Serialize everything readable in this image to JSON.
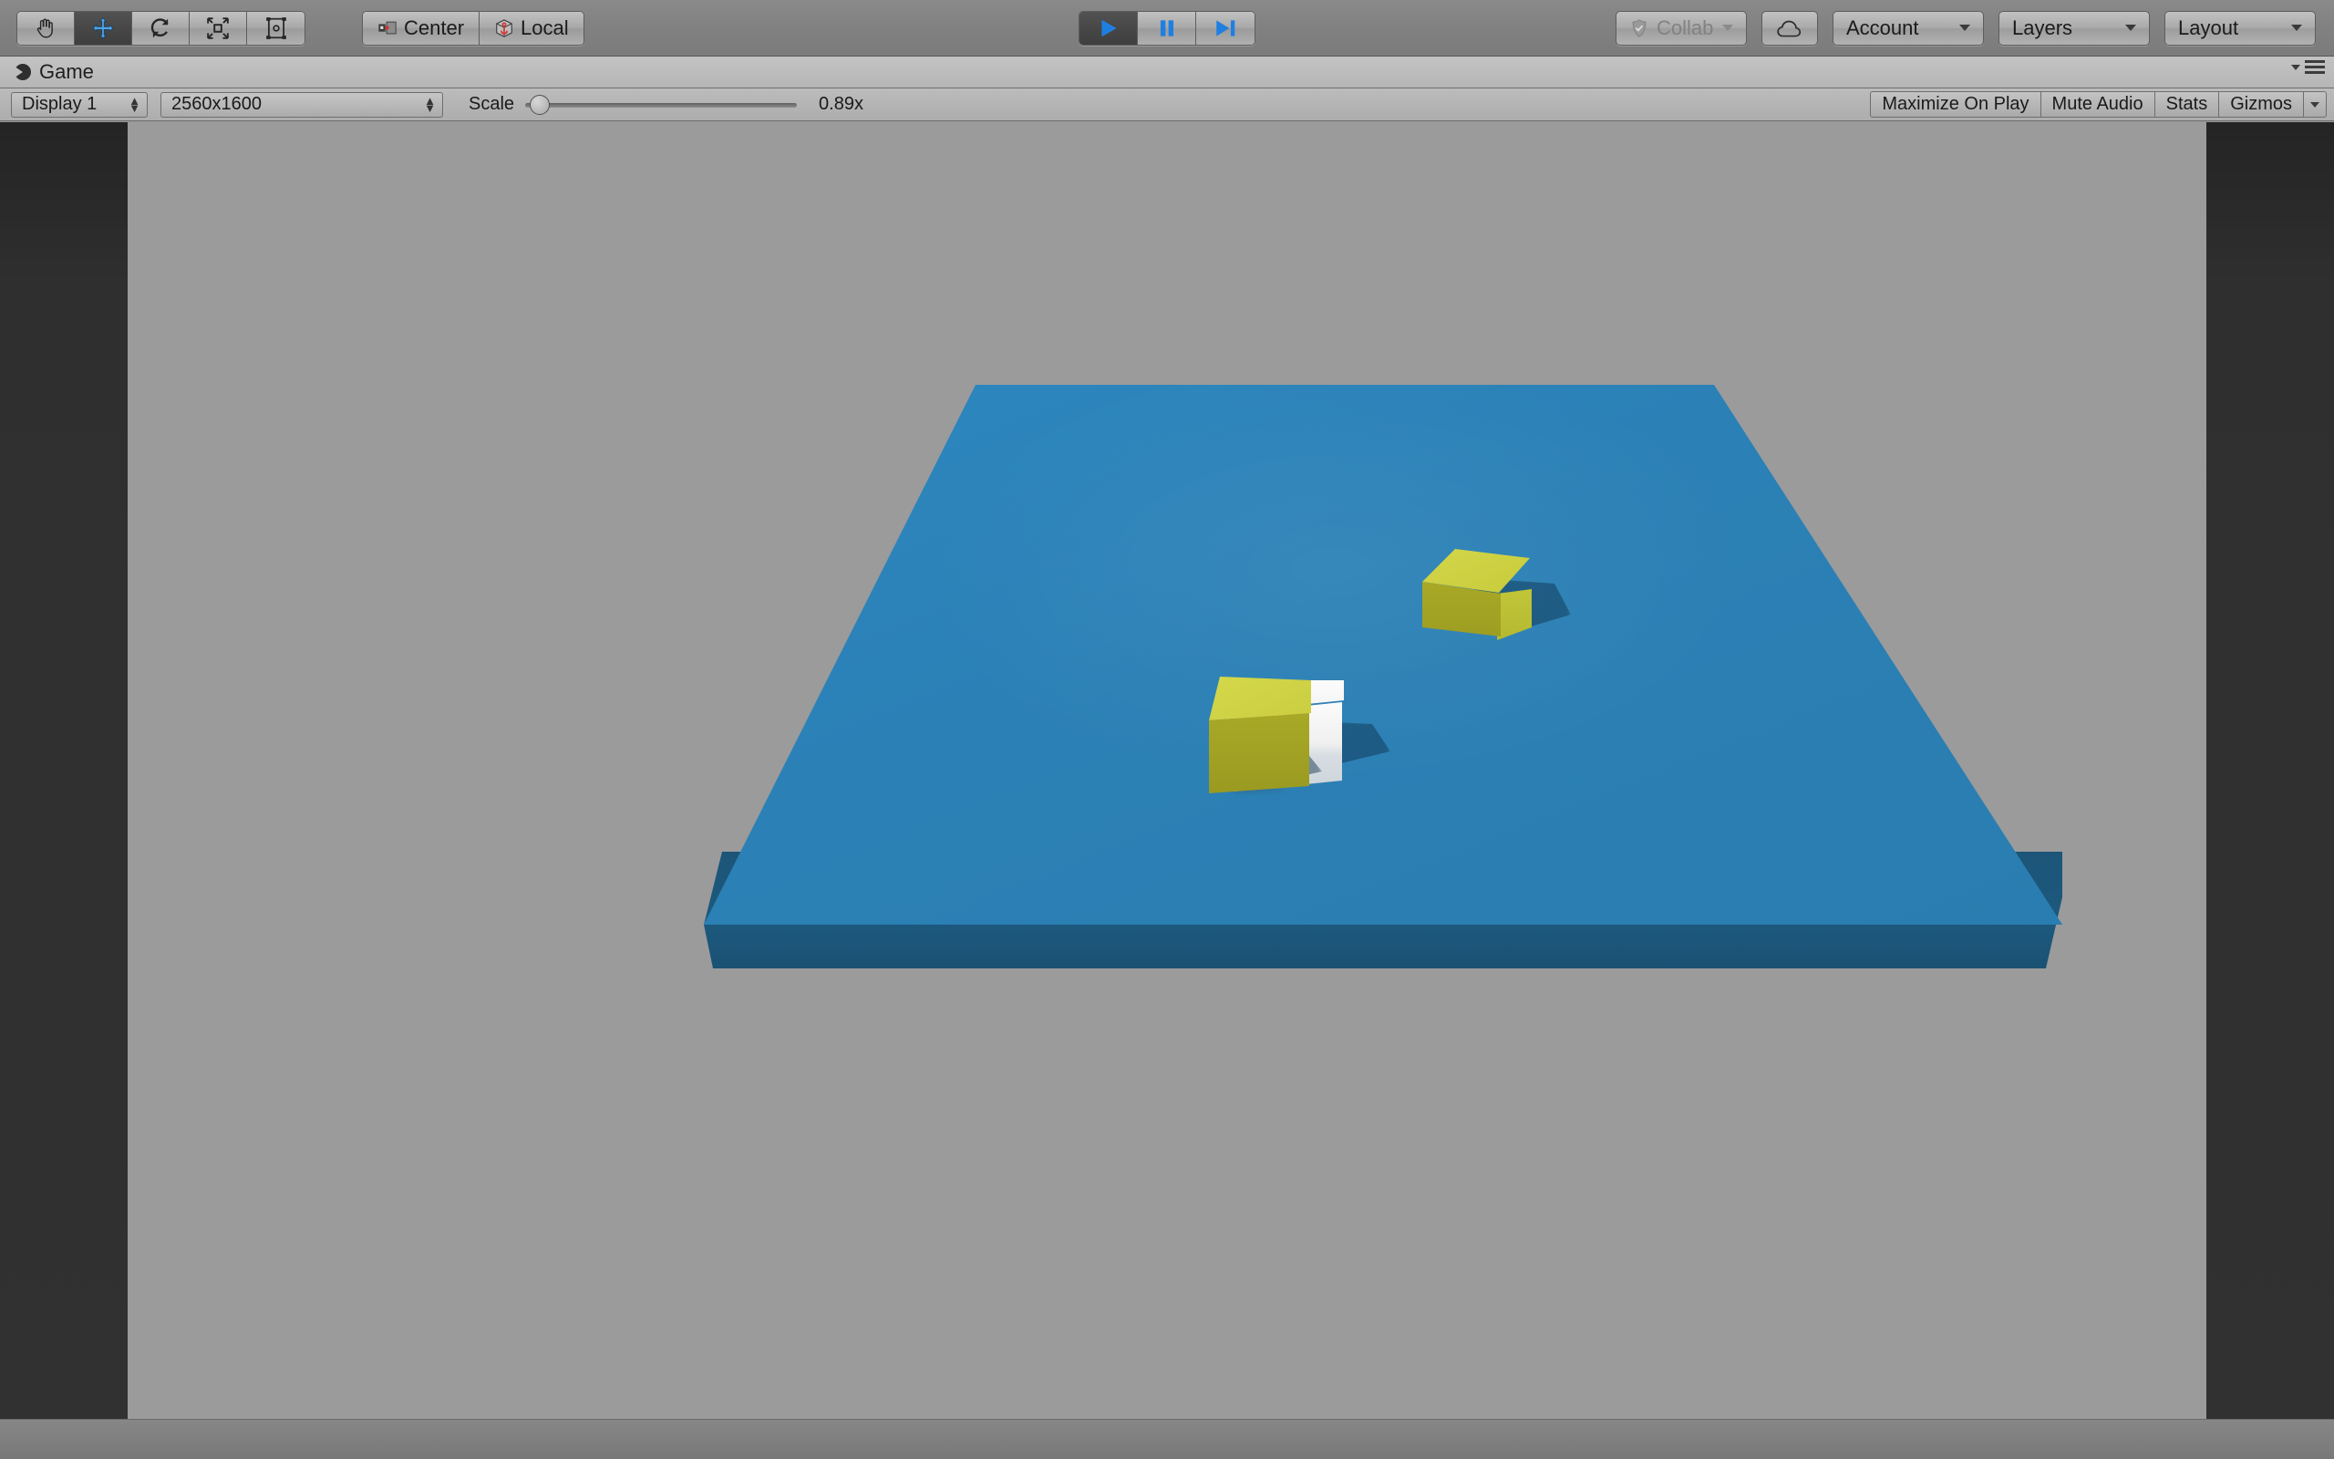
{
  "toolbar": {
    "tools": [
      {
        "name": "hand-tool",
        "icon": "hand",
        "active": false
      },
      {
        "name": "move-tool",
        "icon": "move",
        "active": true
      },
      {
        "name": "rotate-tool",
        "icon": "rotate",
        "active": false
      },
      {
        "name": "scale-tool",
        "icon": "scale",
        "active": false
      },
      {
        "name": "rect-tool",
        "icon": "rect",
        "active": false
      }
    ],
    "pivot_label": "Center",
    "handle_label": "Local",
    "play_label": "Play",
    "pause_label": "Pause",
    "step_label": "Step",
    "play_active": true,
    "collab_label": "Collab",
    "collab_disabled": true,
    "cloud_label": "Cloud",
    "account_label": "Account",
    "layers_label": "Layers",
    "layout_label": "Layout"
  },
  "game_panel": {
    "tab_label": "Game",
    "display_label": "Display 1",
    "resolution_label": "2560x1600",
    "scale_label": "Scale",
    "scale_value": "0.89x",
    "scale_fraction": 0.02,
    "maximize_label": "Maximize On Play",
    "mute_label": "Mute Audio",
    "stats_label": "Stats",
    "gizmos_label": "Gizmos"
  },
  "scene": {
    "background_color": "#9b9b9b",
    "letterbox_color": "#2b2b2b",
    "plane_top_color": "#2b80b5",
    "plane_side_color": "#1d597e",
    "cube_yellow_top_color": "#cdd13f",
    "cube_yellow_front_color": "#a8a827",
    "cube_white_color": "#fbfbfb",
    "objects": [
      {
        "name": "cube-far-yellow",
        "color": "#cdd13f"
      },
      {
        "name": "cube-near-yellow",
        "color": "#cdd13f"
      },
      {
        "name": "cube-white",
        "color": "#fbfbfb"
      },
      {
        "name": "ground-plane",
        "color": "#2b80b5"
      }
    ]
  }
}
